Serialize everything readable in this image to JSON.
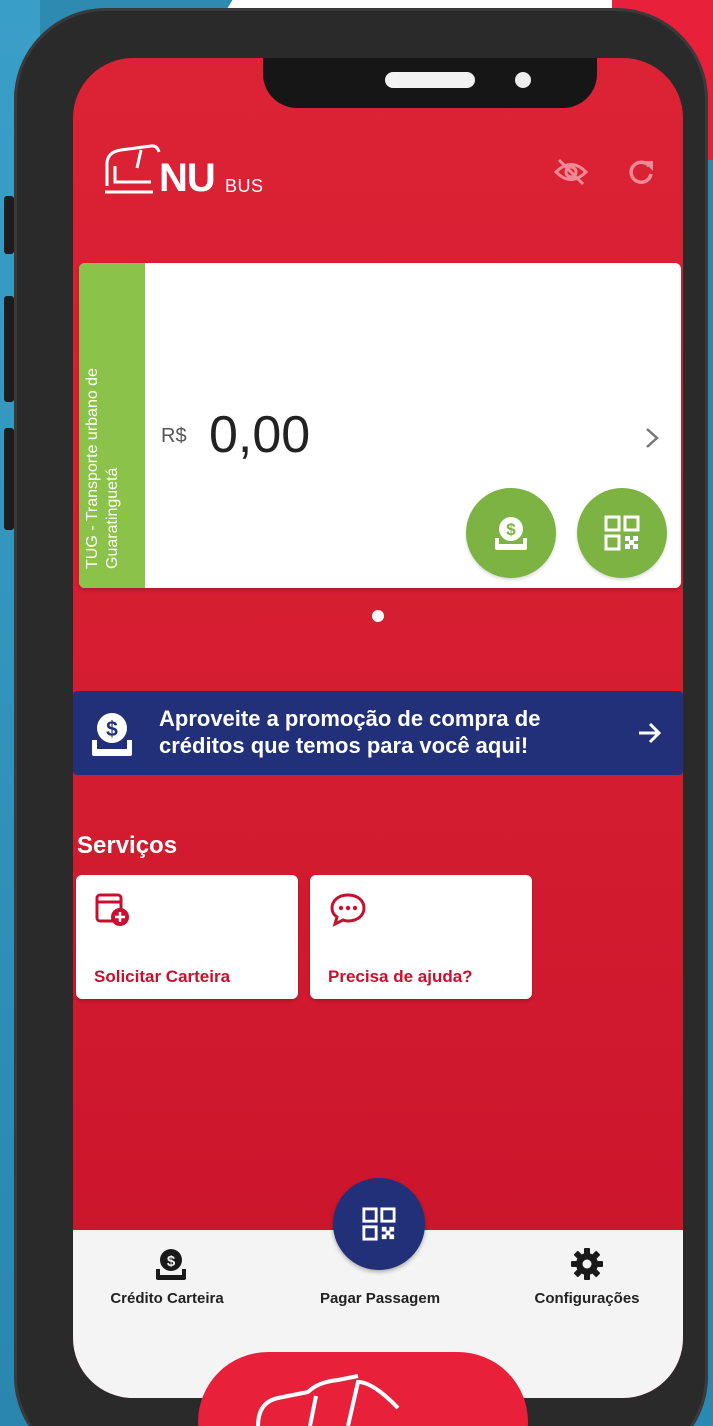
{
  "app": {
    "logo_nu": "NU",
    "logo_bus": "BUS"
  },
  "card": {
    "operator": "TUG - Transporte urbano de Guaratinguetá",
    "currency": "R$",
    "balance": "0,00"
  },
  "promo": {
    "text": "Aproveite a promoção de compra de créditos que temos para você aqui!"
  },
  "services": {
    "title": "Serviços",
    "items": [
      {
        "label": "Solicitar Carteira",
        "icon": "wallet-add-icon"
      },
      {
        "label": "Precisa de ajuda?",
        "icon": "chat-help-icon"
      }
    ]
  },
  "bottom_nav": {
    "items": [
      {
        "label": "Crédito Carteira",
        "icon": "money-deposit-icon"
      },
      {
        "label": "Pagar Passagem",
        "icon": "qr-code-icon"
      },
      {
        "label": "Configurações",
        "icon": "gear-icon"
      }
    ]
  },
  "colors": {
    "brand_red": "#dc2235",
    "promo_blue": "#22307a",
    "accent_green": "#7cb342",
    "strip_green": "#8bc34a"
  }
}
